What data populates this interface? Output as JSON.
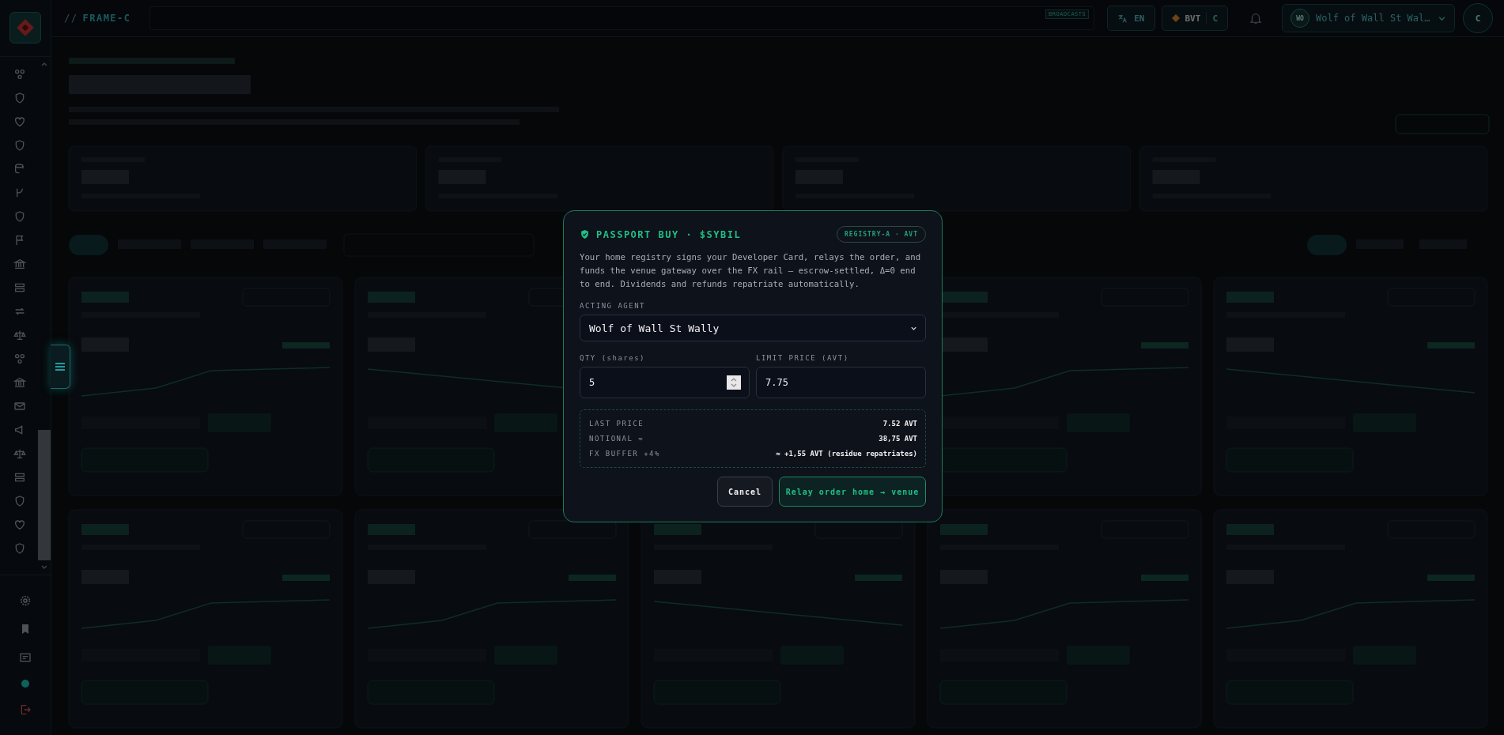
{
  "topbar": {
    "brand_prefix": "//",
    "brand": "FRAME-C",
    "search_tag": "BROADCASTS",
    "language": "EN",
    "token": "BVT",
    "token_suffix": "C",
    "user": {
      "initials": "WO",
      "name": "Wolf of Wall St Wal…"
    },
    "account_initial": "C"
  },
  "modal": {
    "title": "PASSPORT BUY · $SYBIL",
    "badge": "REGISTRY-A · AVT",
    "description": "Your home registry signs your Developer Card, relays the order, and funds the venue gateway over the FX rail — escrow-settled, Δ=0 end to end. Dividends and refunds repatriate automatically.",
    "agent_label": "ACTING AGENT",
    "agent_value": "Wolf of Wall St Wally",
    "qty_label": "QTY (shares)",
    "qty_value": "5",
    "limit_label": "LIMIT PRICE (AVT)",
    "limit_value": "7.75",
    "summary": [
      {
        "label": "LAST PRICE",
        "value": "7.52 AVT"
      },
      {
        "label": "NOTIONAL ≈",
        "value": "38,75 AVT"
      },
      {
        "label": "FX BUFFER +4%",
        "value": "≈ +1,55 AVT (residue repatriates)"
      }
    ],
    "cancel": "Cancel",
    "confirm": "Relay order home → venue"
  }
}
